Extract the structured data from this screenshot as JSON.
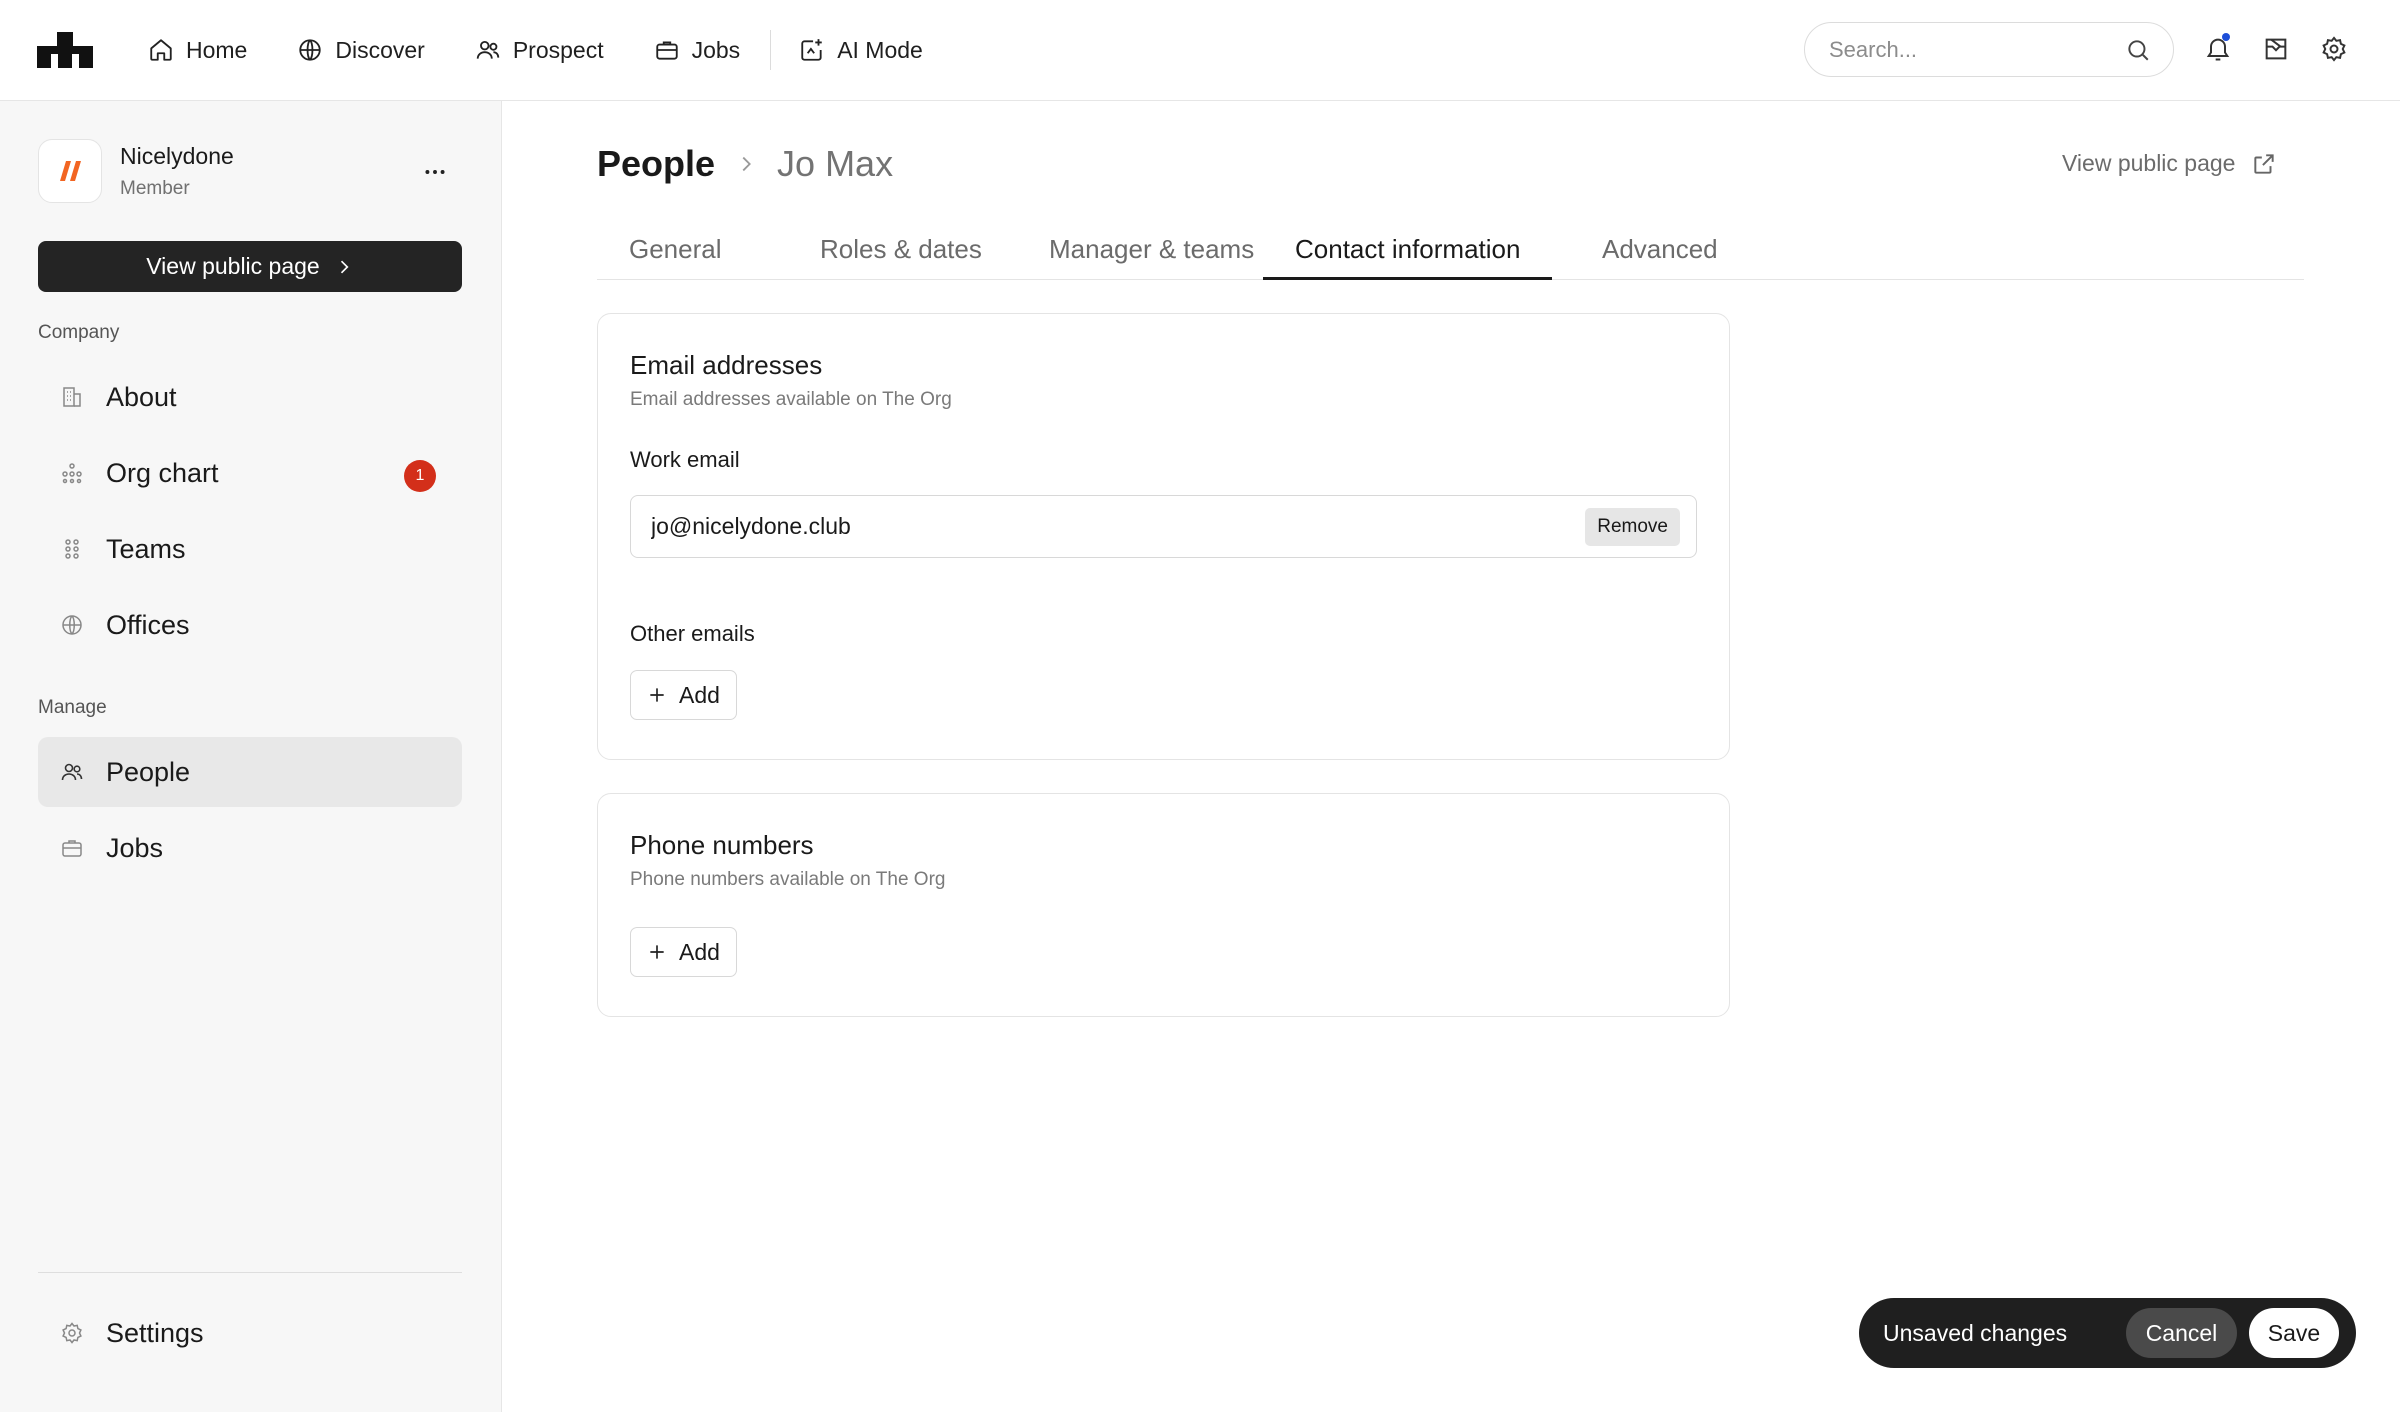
{
  "nav": {
    "logo_icon": "theorg-logo-icon",
    "items": [
      {
        "label": "Home",
        "icon": "home-icon"
      },
      {
        "label": "Discover",
        "icon": "globe-icon"
      },
      {
        "label": "Prospect",
        "icon": "users-icon"
      },
      {
        "label": "Jobs",
        "icon": "briefcase-icon"
      },
      {
        "label": "AI Mode",
        "icon": "sparkle-icon"
      }
    ],
    "search_placeholder": "Search...",
    "icons": [
      "bell-icon",
      "inbox-icon",
      "gear-icon"
    ],
    "notification_dot_color": "#1d4ed8"
  },
  "sidebar": {
    "org_name": "Nicelydone",
    "org_role": "Member",
    "view_public_label": "View public page",
    "company_label": "Company",
    "company_items": [
      {
        "label": "About",
        "icon": "building-icon"
      },
      {
        "label": "Org chart",
        "icon": "org-chart-icon",
        "badge": "1"
      },
      {
        "label": "Teams",
        "icon": "teams-icon"
      },
      {
        "label": "Offices",
        "icon": "globe-icon"
      }
    ],
    "manage_label": "Manage",
    "manage_items": [
      {
        "label": "People",
        "icon": "users-icon",
        "active": true
      },
      {
        "label": "Jobs",
        "icon": "briefcase-icon"
      }
    ],
    "settings_label": "Settings"
  },
  "main": {
    "breadcrumb_root": "People",
    "breadcrumb_current": "Jo Max",
    "view_public_label": "View public page",
    "tabs": [
      {
        "label": "General"
      },
      {
        "label": "Roles & dates"
      },
      {
        "label": "Manager & teams"
      },
      {
        "label": "Contact information",
        "active": true
      },
      {
        "label": "Advanced"
      }
    ],
    "email_card": {
      "title": "Email addresses",
      "subtitle": "Email addresses available on The Org",
      "work_email_label": "Work email",
      "work_email_value": "jo@nicelydone.club",
      "remove_label": "Remove",
      "other_emails_label": "Other emails",
      "add_label": "Add"
    },
    "phone_card": {
      "title": "Phone numbers",
      "subtitle": "Phone numbers available on The Org",
      "add_label": "Add"
    }
  },
  "unsaved": {
    "label": "Unsaved changes",
    "cancel_label": "Cancel",
    "save_label": "Save"
  },
  "colors": {
    "brand_orange": "#f26522",
    "badge_red": "#d32f1a",
    "dark": "#242424"
  }
}
